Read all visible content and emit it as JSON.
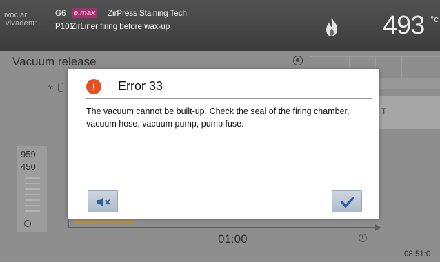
{
  "header": {
    "logo_line1": "ivoclar",
    "logo_line2": "vivadent:",
    "device_group": "G6",
    "brand": "e.max",
    "title": "ZirPress Staining Tech.",
    "program_code": "P101",
    "program_name": "ZirLiner firing before wax-up",
    "temperature": "493",
    "temperature_unit": "°c"
  },
  "screen": {
    "stage_label": "Vacuum release",
    "temp_unit_label": "°c",
    "right_button_label": "T",
    "side_value_1": "959",
    "side_value_2": "450",
    "time_remaining": "01:00",
    "system_time": "08:51:0",
    "progress_fraction": 0.2
  },
  "dialog": {
    "title": "Error 33",
    "message": "The vacuum cannot be built-up. Check the seal of the firing chamber, vacuum hose, vacuum pump, pump fuse.",
    "icon_glyph": "!",
    "buttons": {
      "mute_icon": "speaker-mute-icon",
      "ok_icon": "checkmark-icon"
    }
  },
  "colors": {
    "error_accent": "#e8501e",
    "brand_badge": "#a1316e",
    "progress": "#c68f1c",
    "button_icon": "#2d5fa3"
  }
}
